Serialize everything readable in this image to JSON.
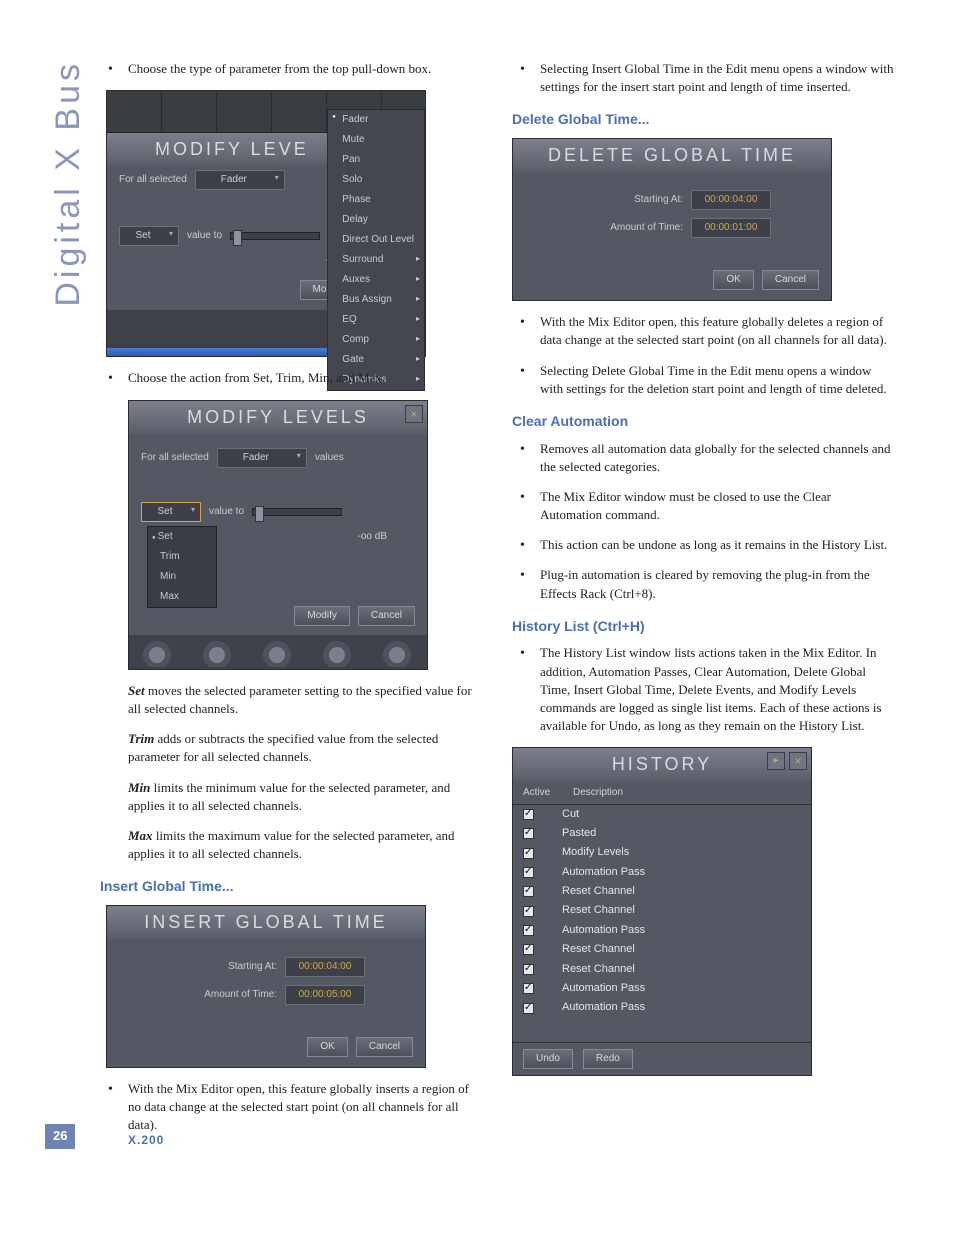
{
  "sidebar": {
    "label": "Digital X Bus"
  },
  "footer": {
    "page": "26",
    "product": "X.200"
  },
  "left": {
    "p1": "Choose the type of parameter from the top pull-down box.",
    "p2": "Choose the action from Set, Trim, Min, and Max.",
    "set": "Set moves the selected parameter setting to the specified value for all selected channels.",
    "trim": "Trim adds or subtracts the specified value from the selected parameter for all selected channels.",
    "min": "Min limits the minimum value for the selected parameter, and applies it to all selected channels.",
    "max": "Max limits the maximum value for the selected parameter, and applies it to all selected channels.",
    "heading_insert": "Insert Global Time...",
    "p3": "With the Mix Editor open, this feature globally inserts a region of no data change at the selected start point (on all channels for all data)."
  },
  "right": {
    "p0": "Selecting Insert Global Time in the Edit menu opens a window with settings for the insert start point and length of time inserted.",
    "heading_delete": "Delete Global Time...",
    "p1": "With the Mix Editor open, this feature globally deletes a region of data change at the selected start point (on all channels for all data).",
    "p2": "Selecting Delete Global Time in the Edit menu opens a window with settings for the deletion start point and length of time deleted.",
    "heading_clear": "Clear Automation",
    "c1": "Removes all automation data globally for the selected channels and the selected categories.",
    "c2": "The Mix Editor window must be closed to use the Clear Automation command.",
    "c3": "This action can be undone as long as it remains in the History List.",
    "c4": "Plug-in automation is cleared by removing the plug-in from the Effects Rack (Ctrl+8).",
    "heading_history": "History List (Ctrl+H)",
    "h1": "The History List window lists actions taken in the Mix Editor. In addition, Automation Passes, Clear Automation, Delete Global Time, Insert Global Time, Delete Events, and Modify Levels commands are logged as single list items. Each of these actions is available for Undo, as long as they remain on the History List."
  },
  "ui": {
    "modify_title_short": "MODIFY LEVE",
    "modify_title": "MODIFY LEVELS",
    "for_all_selected": "For all selected",
    "fader": "Fader",
    "values": "values",
    "set": "Set",
    "value_to": "value to",
    "neg_inf": "-oo dB",
    "modify_btn": "Modify",
    "cancel_btn": "Cancel",
    "ok_btn": "OK",
    "close": "×",
    "arrow": "▸",
    "param_menu": [
      "Fader",
      "Mute",
      "Pan",
      "Solo",
      "Phase",
      "Delay",
      "Direct Out Level",
      "Surround",
      "Auxes",
      "Bus Assign",
      "EQ",
      "Comp",
      "Gate",
      "Dynamics"
    ],
    "param_menu_sub": [
      false,
      false,
      false,
      false,
      false,
      false,
      false,
      true,
      true,
      true,
      true,
      true,
      true,
      true
    ],
    "action_menu": [
      "Set",
      "Trim",
      "Min",
      "Max"
    ],
    "insert_title": "INSERT GLOBAL TIME",
    "delete_title": "DELETE GLOBAL TIME",
    "starting_at": "Starting At:",
    "amount_of_time": "Amount of Time:",
    "insert_start": "00:00:04:00",
    "insert_amount": "00:00:05:00",
    "delete_start": "00:00:04:00",
    "delete_amount": "00:00:01:00",
    "history_title": "HISTORY",
    "history_cols": {
      "active": "Active",
      "desc": "Description"
    },
    "history_items": [
      "Cut",
      "Pasted",
      "Modify Levels",
      "Automation Pass",
      "Reset Channel",
      "Reset Channel",
      "Automation Pass",
      "Reset Channel",
      "Reset Channel",
      "Automation Pass",
      "Automation Pass"
    ],
    "undo": "Undo",
    "redo": "Redo"
  }
}
